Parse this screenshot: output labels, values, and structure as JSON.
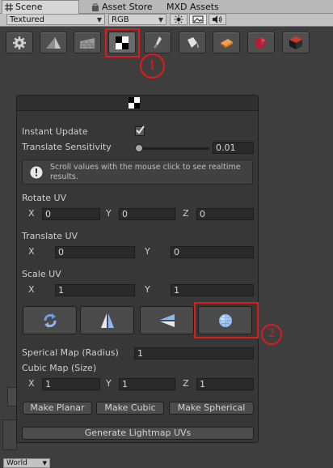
{
  "tabs": [
    {
      "label": "Scene",
      "icon": "hash-icon"
    },
    {
      "label": "Asset Store",
      "icon": "bag-icon"
    },
    {
      "label": "MXD Assets"
    }
  ],
  "scene_toolbar": {
    "render_mode": "Textured",
    "color_mode": "RGB",
    "toggles": [
      "sun-icon",
      "image-icon",
      "speaker-icon"
    ]
  },
  "tool_icons": [
    "gear-icon",
    "pyramid-icon",
    "wall-icon",
    "checker-icon",
    "brush-icon",
    "paint-bucket-icon",
    "eraser-icon",
    "red-gem-icon",
    "box-icon"
  ],
  "annotations": {
    "one": "1",
    "two": "2"
  },
  "panel": {
    "header_icon": "checker-icon",
    "instant_update": {
      "label": "Instant Update",
      "checked": true
    },
    "translate_sensitivity": {
      "label": "Translate Sensitivity",
      "value": "0.01",
      "slider_fraction": 0.0
    },
    "help_text": "Scroll values with the mouse click to see realtime results.",
    "rotate_uv": {
      "label": "Rotate UV",
      "x_label": "X",
      "y_label": "Y",
      "z_label": "Z",
      "x": "0",
      "y": "0",
      "z": "0"
    },
    "translate_uv": {
      "label": "Translate UV",
      "x_label": "X",
      "y_label": "Y",
      "x": "0",
      "y": "0"
    },
    "scale_uv": {
      "label": "Scale UV",
      "x_label": "X",
      "y_label": "Y",
      "x": "1",
      "y": "1"
    },
    "projection_buttons": [
      "rotate-arrows-icon",
      "flip-vertical-icon",
      "flip-horizontal-icon",
      "sphere-icon"
    ],
    "spherical_map": {
      "label": "Sperical Map (Radius)",
      "value": "1"
    },
    "cubic_map": {
      "label": "Cubic Map (Size)",
      "x_label": "X",
      "y_label": "Y",
      "z_label": "Z",
      "x": "1",
      "y": "1",
      "z": "1"
    },
    "make_planar": "Make Planar",
    "make_cubic": "Make Cubic",
    "make_spherical": "Make Spherical",
    "generate_lightmap": "Generate Lightmap UVs"
  },
  "world_dropdown": "World",
  "colors": {
    "annotation": "#e11a1a",
    "panel_bg": "#373737",
    "editor_bg": "#3e3e3e"
  }
}
